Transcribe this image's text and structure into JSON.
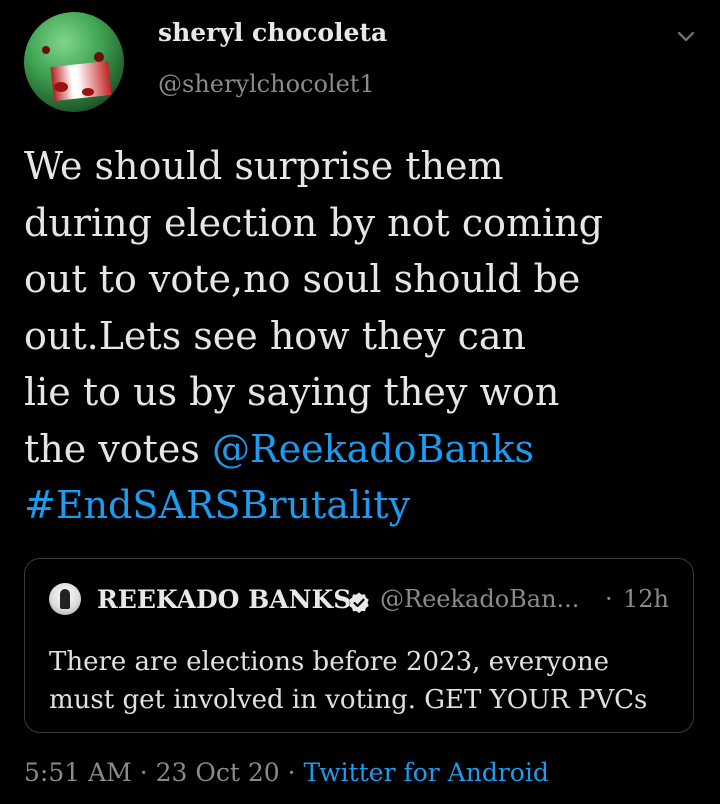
{
  "author": {
    "name": "sheryl chocoleta",
    "handle": "@sherylchocolet1"
  },
  "tweet": {
    "text_plain": "We should surprise them\nduring election by not coming\nout to vote,no soul should be\nout.Lets see how they can\nlie to us by saying they won\nthe votes ",
    "mention": "@ReekadoBanks",
    "hashtag": "#EndSARSBrutality"
  },
  "quoted_tweet": {
    "name": "REEKADO BANKS",
    "handle": "@ReekadoBan...",
    "separator": "·",
    "time": "12h",
    "text": "There are elections before 2023, everyone must get involved in voting. GET YOUR PVCs"
  },
  "meta": {
    "time": "5:51 AM",
    "sep1": " · ",
    "date": "23 Oct 20",
    "sep2": " · ",
    "source": "Twitter for Android"
  },
  "colors": {
    "background": "#000000",
    "link": "#1d9bf0",
    "secondary_text": "#8a8a8a"
  },
  "icons": [
    "more-options-chevron-icon",
    "verified-badge-icon"
  ]
}
